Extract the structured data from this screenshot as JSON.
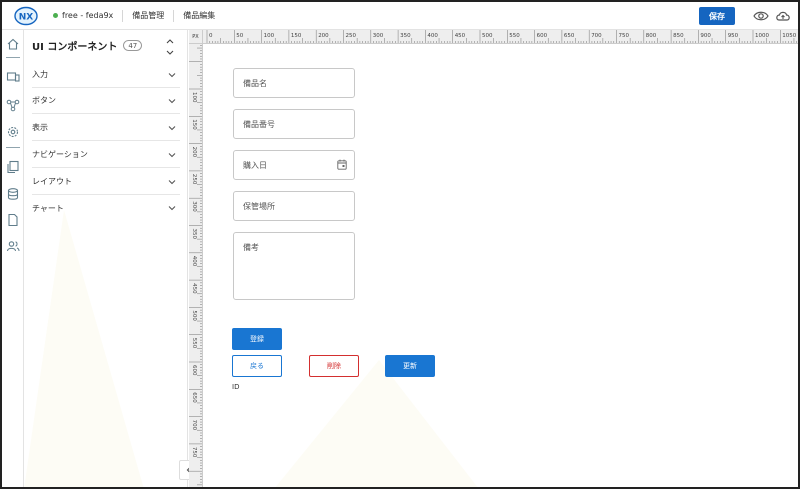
{
  "header": {
    "logo_text": "NX",
    "status_text": "free - feda9x",
    "breadcrumbs": [
      "備品管理",
      "備品編集"
    ],
    "save_label": "保存",
    "accent_color": "#1565c0",
    "status_color": "#4caf50"
  },
  "rail": {
    "icons": [
      "home-icon",
      "devices-icon",
      "flow-icon",
      "settings-icon",
      "pages-icon",
      "database-icon",
      "file-icon",
      "users-icon"
    ]
  },
  "panel": {
    "title": "UI コンポーネント",
    "count": "47",
    "categories": [
      "入力",
      "ボタン",
      "表示",
      "ナビゲーション",
      "レイアウト",
      "チャート"
    ]
  },
  "ruler": {
    "unit": "PX",
    "h_labels": [
      "0",
      "50",
      "100",
      "150",
      "200",
      "250",
      "300",
      "350",
      "400",
      "450",
      "500",
      "550",
      "600",
      "650",
      "700",
      "750",
      "800",
      "850",
      "900",
      "950",
      "1000",
      "1050"
    ],
    "v_labels": [
      "100",
      "150",
      "200",
      "250",
      "300",
      "350",
      "400",
      "450",
      "500",
      "550",
      "600",
      "650",
      "700",
      "750"
    ]
  },
  "form": {
    "name_placeholder": "備品名",
    "number_placeholder": "備品番号",
    "date_placeholder": "購入日",
    "location_placeholder": "保管場所",
    "notes_placeholder": "備考",
    "register_label": "登録",
    "back_label": "戻る",
    "delete_label": "削除",
    "update_label": "更新",
    "id_label": "ID"
  }
}
